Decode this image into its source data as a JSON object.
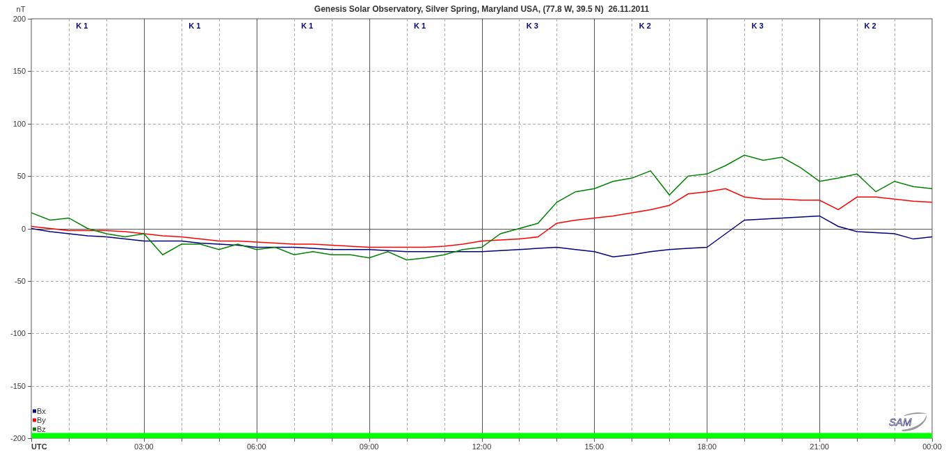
{
  "chart_data": {
    "type": "line",
    "title": "Genesis Solar Observatory, Silver Spring, Maryland USA, (77.8 W, 39.5 N)  26.11.2011",
    "ylabel": "nT",
    "ylim": [
      -200,
      200
    ],
    "xlim": [
      0,
      24
    ],
    "yticks": [
      200,
      150,
      100,
      50,
      0,
      -50,
      -100,
      -150,
      -200
    ],
    "xticks": [
      {
        "value": 0,
        "label": "UTC"
      },
      {
        "value": 3,
        "label": "03:00"
      },
      {
        "value": 6,
        "label": "06:00"
      },
      {
        "value": 9,
        "label": "09:00"
      },
      {
        "value": 12,
        "label": "12:00"
      },
      {
        "value": 15,
        "label": "15:00"
      },
      {
        "value": 18,
        "label": "18:00"
      },
      {
        "value": 21,
        "label": "21:00"
      },
      {
        "value": 24,
        "label": "00:00"
      }
    ],
    "x": [
      0,
      0.5,
      1,
      1.5,
      2,
      2.5,
      3,
      3.5,
      4,
      4.5,
      5,
      5.5,
      6,
      6.5,
      7,
      7.5,
      8,
      8.5,
      9,
      9.5,
      10,
      10.5,
      11,
      11.5,
      12,
      12.5,
      13,
      13.5,
      14,
      14.5,
      15,
      15.5,
      16,
      16.5,
      17,
      17.5,
      18,
      18.5,
      19,
      19.5,
      20,
      20.5,
      21,
      21.5,
      22,
      22.5,
      23,
      23.5,
      24
    ],
    "series": [
      {
        "name": "Bx",
        "color": "#000080",
        "values": [
          0,
          -3,
          -5,
          -7,
          -8,
          -10,
          -12,
          -12,
          -12,
          -14,
          -15,
          -16,
          -18,
          -18,
          -18,
          -19,
          -20,
          -20,
          -20,
          -21,
          -22,
          -22,
          -22,
          -22,
          -22,
          -21,
          -20,
          -19,
          -18,
          -20,
          -22,
          -27,
          -25,
          -22,
          -20,
          -19,
          -18,
          -5,
          8,
          9,
          10,
          11,
          12,
          2,
          -3,
          -4,
          -5,
          -10,
          -8
        ]
      },
      {
        "name": "By",
        "color": "#ff0000",
        "values": [
          2,
          0,
          -2,
          -2,
          -2,
          -3,
          -5,
          -7,
          -8,
          -10,
          -12,
          -12,
          -13,
          -14,
          -15,
          -15,
          -16,
          -17,
          -18,
          -18,
          -18,
          -18,
          -17,
          -15,
          -12,
          -11,
          -10,
          -8,
          5,
          8,
          10,
          12,
          15,
          18,
          22,
          33,
          35,
          38,
          30,
          28,
          28,
          27,
          27,
          18,
          30,
          30,
          28,
          26,
          25
        ]
      },
      {
        "name": "Bz",
        "color": "#008000",
        "values": [
          15,
          8,
          10,
          0,
          -5,
          -8,
          -5,
          -25,
          -15,
          -15,
          -20,
          -15,
          -20,
          -18,
          -25,
          -22,
          -25,
          -25,
          -28,
          -22,
          -30,
          -28,
          -25,
          -20,
          -18,
          -5,
          0,
          5,
          25,
          35,
          38,
          45,
          48,
          55,
          32,
          50,
          52,
          60,
          70,
          65,
          68,
          58,
          45,
          48,
          52,
          35,
          45,
          40,
          38
        ]
      }
    ],
    "grid": true,
    "legend": true,
    "bands": [
      {
        "axis": "y",
        "from": -200,
        "to": -195,
        "color": "#00ff00"
      }
    ]
  },
  "k_indices": [
    "K 1",
    "K 1",
    "K 1",
    "K 1",
    "K 3",
    "K 2",
    "K 3",
    "K 2"
  ],
  "logo": {
    "text": "SAM"
  }
}
